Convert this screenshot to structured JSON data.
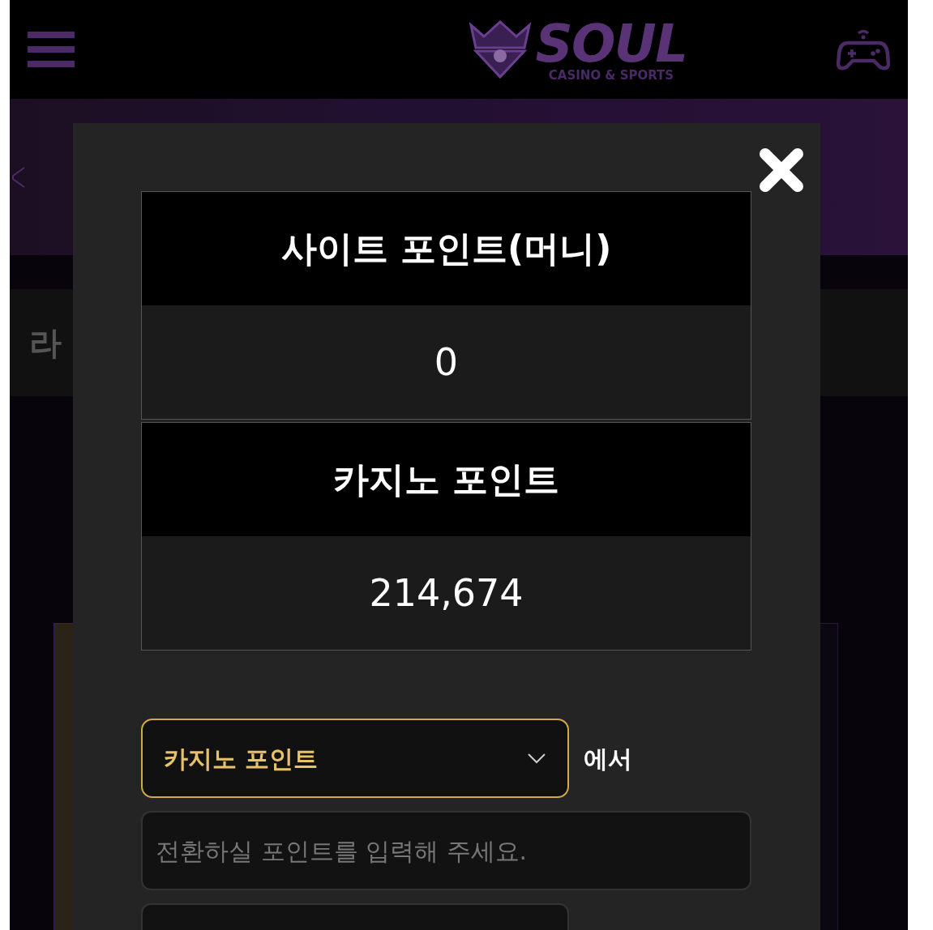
{
  "header": {
    "logo_title": "SOUL",
    "logo_subtitle": "CASINO & SPORTS"
  },
  "background": {
    "section_label": "라"
  },
  "modal": {
    "points": [
      {
        "label": "사이트 포인트(머니)",
        "value": "0"
      },
      {
        "label": "카지노 포인트",
        "value": "214,674"
      }
    ],
    "source_select": {
      "value": "카지노 포인트",
      "suffix": "에서"
    },
    "amount_field": {
      "placeholder": "전환하실 포인트를 입력해 주세요."
    }
  }
}
